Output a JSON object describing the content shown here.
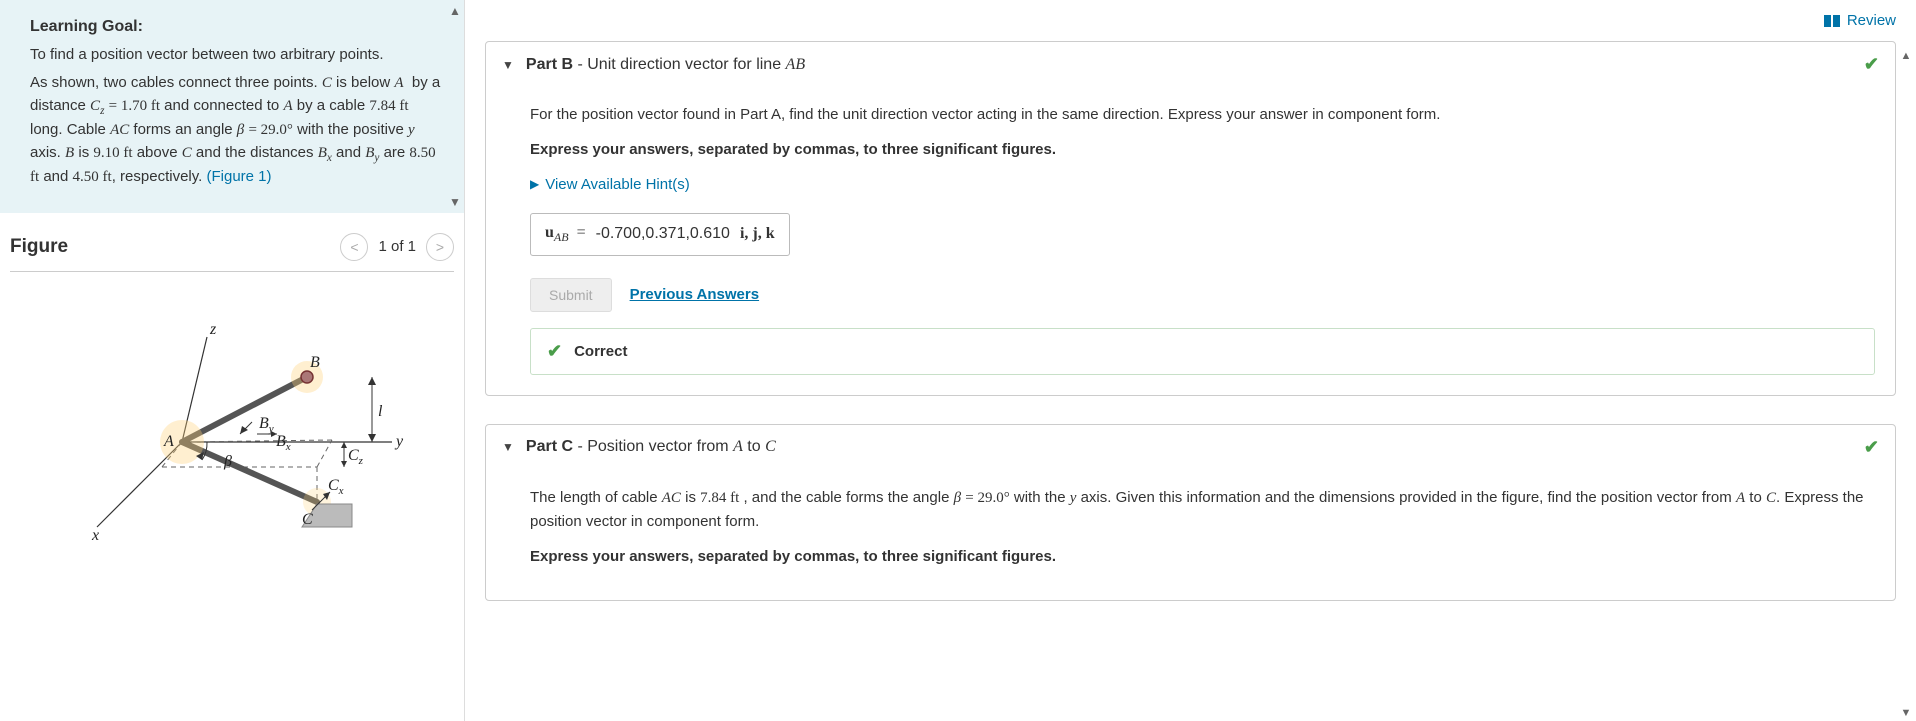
{
  "left": {
    "learning_goal_title": "Learning Goal:",
    "learning_goal_intro": "To find a position vector between two arbitrary points.",
    "problem_html": "As shown, two cables connect three points. <span class='math'>C</span> is below <span class='math'>A</span> &nbsp;by a distance <span class='math'>C<sub>z</sub></span> <span class='mathrm'>= 1.70 ft</span> and connected to <span class='math'>A</span> by a cable <span class='mathrm'>7.84 ft</span> long. Cable <span class='math'>AC</span> forms an angle <span class='math'>β</span> <span class='mathrm'>= 29.0°</span> with the positive <span class='math'>y</span> axis. <span class='math'>B</span> is <span class='mathrm'>9.10 ft</span> above <span class='math'>C</span> and the distances <span class='math'>B<sub>x</sub></span> and <span class='math'>B<sub>y</sub></span> are <span class='mathrm'>8.50 ft</span> and <span class='mathrm'>4.50 ft</span>, respectively. <span class='fig-link'>(Figure 1)</span>",
    "figure_title": "Figure",
    "figure_count": "1 of 1"
  },
  "review": "Review",
  "partB": {
    "title_prefix": "Part B",
    "title_rest": " - Unit direction vector for line ",
    "title_var": "AB",
    "description": "For the position vector found in Part A, find the unit direction vector acting in the same direction. Express your answer in component form.",
    "instruction": "Express your answers, separated by commas, to three significant figures.",
    "hints": "View Available Hint(s)",
    "answer_label_html": "<b>u</b><sub><i>AB</i></sub> &nbsp;=",
    "answer_value": "-0.700,0.371,0.610",
    "answer_unit_html": "i, j, k",
    "submit": "Submit",
    "previous": "Previous Answers",
    "correct": "Correct"
  },
  "partC": {
    "title_prefix": "Part C",
    "title_rest": " - Position vector from ",
    "title_var1": "A",
    "title_mid": " to ",
    "title_var2": "C",
    "description_html": "The length of cable <span class='math'>AC</span> is <span class='mathrm'>7.84 ft</span> , and the cable forms the angle <span class='math'>β</span> <span class='mathrm'>= 29.0°</span> with the <span class='math'>y</span> axis. Given this information and the dimensions provided in the figure, find the position vector from <span class='math'>A</span> to <span class='math'>C</span>. Express the position vector in component form.",
    "instruction": "Express your answers, separated by commas, to three significant figures."
  }
}
